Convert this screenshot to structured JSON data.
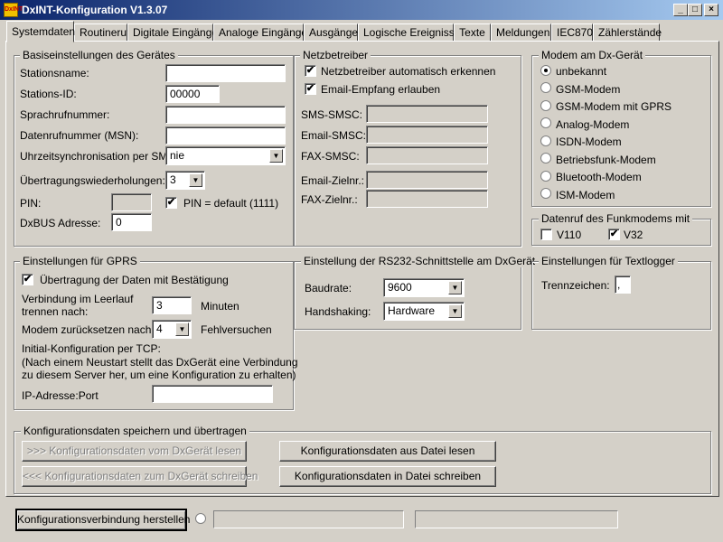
{
  "window": {
    "title": "DxINT-Konfiguration V1.3.07",
    "icon_label": "DxINT",
    "minimize": "_",
    "maximize": "□",
    "close": "×"
  },
  "tabs": [
    "Systemdaten",
    "Routineruf",
    "Digitale Eingänge",
    "Analoge Eingänge",
    "Ausgänge",
    "Logische Ereignisse",
    "Texte",
    "Meldungen",
    "IEC870",
    "Zählerstände"
  ],
  "basis": {
    "legend": "Basiseinstellungen des Gerätes",
    "stationsname_label": "Stationsname:",
    "stationsname_value": "",
    "stations_id_label": "Stations-ID:",
    "stations_id_value": "00000",
    "sprachruf_label": "Sprachrufnummer:",
    "sprachruf_value": "",
    "datenruf_label": "Datenrufnummer (MSN):",
    "datenruf_value": "",
    "uhrzeit_label": "Uhrzeitsynchronisation per SMS:",
    "uhrzeit_value": "nie",
    "wiederholungen_label": "Übertragungswiederholungen:",
    "wiederholungen_value": "3",
    "pin_label": "PIN:",
    "pin_value": "",
    "pin_default_label": "PIN = default (1111)",
    "pin_default_checked": true,
    "dxbus_label": "DxBUS Adresse:",
    "dxbus_value": "0"
  },
  "netz": {
    "legend": "Netzbetreiber",
    "auto_label": "Netzbetreiber automatisch erkennen",
    "auto_checked": true,
    "email_label": "Email-Empfang erlauben",
    "email_checked": true,
    "sms_smsc_label": "SMS-SMSC:",
    "email_smsc_label": "Email-SMSC:",
    "fax_smsc_label": "FAX-SMSC:",
    "email_zielnr_label": "Email-Zielnr.:",
    "fax_zielnr_label": "FAX-Zielnr.:"
  },
  "modem": {
    "legend": "Modem am Dx-Gerät",
    "options": [
      "unbekannt",
      "GSM-Modem",
      "GSM-Modem mit GPRS",
      "Analog-Modem",
      "ISDN-Modem",
      "Betriebsfunk-Modem",
      "Bluetooth-Modem",
      "ISM-Modem"
    ],
    "selected": "unbekannt"
  },
  "datenruf": {
    "legend": "Datenruf des Funkmodems mit",
    "v110_label": "V110",
    "v110_checked": false,
    "v32_label": "V32",
    "v32_checked": true
  },
  "gprs": {
    "legend": "Einstellungen für GPRS",
    "bestaetigung_label": "Übertragung der Daten mit Bestätigung",
    "bestaetigung_checked": true,
    "leerlauf_label_1": "Verbindung im Leerlauf",
    "leerlauf_label_2": "trennen nach:",
    "leerlauf_value": "3",
    "minuten_label": "Minuten",
    "reset_label": "Modem zurücksetzen nach:",
    "reset_value": "4",
    "fehlversuchen_label": "Fehlversuchen",
    "tcp_title": "Initial-Konfiguration per TCP:",
    "tcp_note_1": "(Nach einem Neustart stellt das DxGerät eine Verbindung",
    "tcp_note_2": "zu diesem Server her, um eine Konfiguration zu erhalten)",
    "ip_label": "IP-Adresse:Port",
    "ip_value": ""
  },
  "rs232": {
    "legend": "Einstellung der RS232-Schnittstelle am DxGerät",
    "baudrate_label": "Baudrate:",
    "baudrate_value": "9600",
    "handshaking_label": "Handshaking:",
    "handshaking_value": "Hardware"
  },
  "textlogger": {
    "legend": "Einstellungen für Textlogger",
    "trennzeichen_label": "Trennzeichen:",
    "trennzeichen_value": ","
  },
  "konfig": {
    "legend": "Konfigurationsdaten speichern und übertragen",
    "lesen_geraet": ">>>  Konfigurationsdaten vom DxGerät lesen",
    "schreiben_geraet": "<<<  Konfigurationsdaten zum DxGerät schreiben",
    "lesen_datei": "Konfigurationsdaten aus Datei lesen",
    "schreiben_datei": "Konfigurationsdaten in Datei schreiben"
  },
  "bottom": {
    "verbindung_button": "Konfigurationsverbindung herstellen",
    "status1": "",
    "status2": ""
  }
}
